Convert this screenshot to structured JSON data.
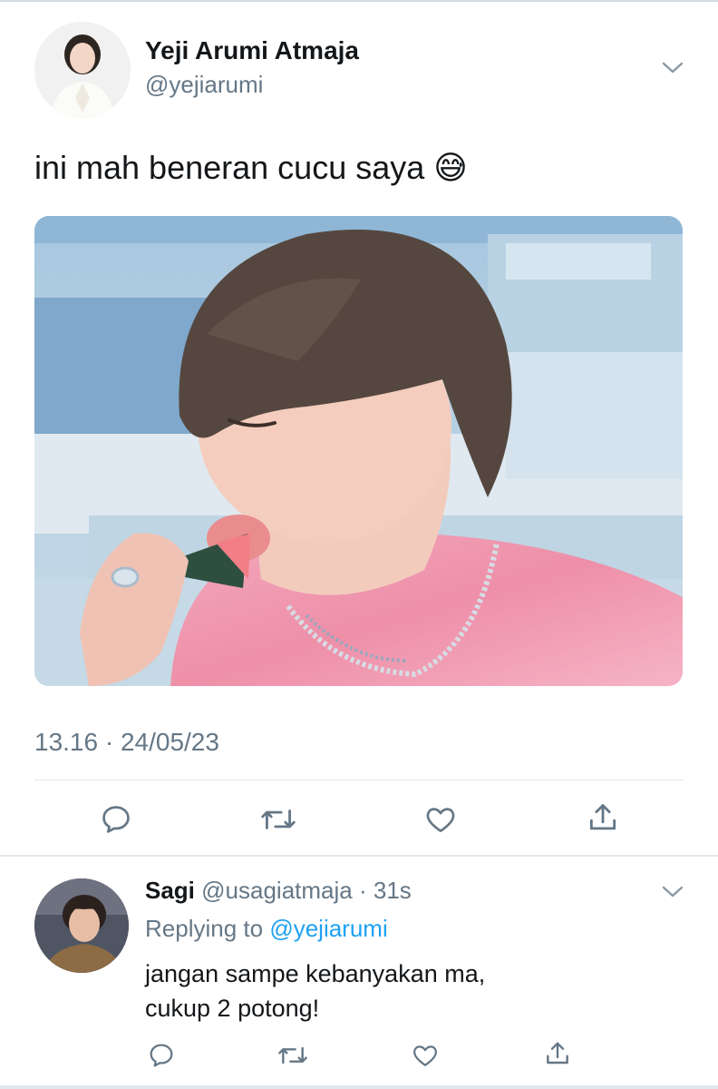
{
  "tweet": {
    "author_name": "Yeji Arumi Atmaja",
    "author_handle": "@yejiarumi",
    "text": "ini mah beneran cucu saya",
    "emoji": "😅",
    "timestamp": "13.16 · 24/05/23"
  },
  "reply": {
    "author_name": "Sagi",
    "author_handle": "@usagiatmaja",
    "time": "· 31s",
    "replying_prefix": "Replying to",
    "replying_handle": "@yejiarumi",
    "text_line1": "jangan sampe kebanyakan ma,",
    "text_line2": "cukup 2 potong!"
  },
  "icons": [
    "chevron-down-icon",
    "reply-icon",
    "retweet-icon",
    "like-icon",
    "share-icon"
  ],
  "colors": {
    "accent": "#1da1f2",
    "muted": "#657786",
    "divider": "#e1e8ed"
  }
}
